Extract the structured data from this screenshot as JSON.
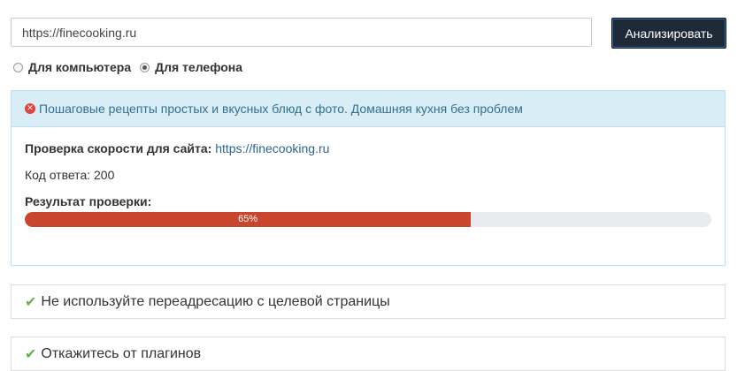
{
  "form": {
    "url_value": "https://finecooking.ru",
    "analyze_label": "Анализировать",
    "radio_desktop": "Для компьютера",
    "radio_mobile": "Для телефона",
    "selected": "mobile"
  },
  "result": {
    "header_text": "Пошаговые рецепты простых и вкусных блюд с фото. Домашняя кухня без проблем",
    "speed_label": "Проверка скорости для сайта:",
    "speed_url": "https://finecooking.ru",
    "response_code_label": "Код ответа: 200",
    "result_label": "Результат проверки:",
    "progress_percent": 65,
    "progress_text": "65%",
    "progress_color": "#c9452e"
  },
  "rules": [
    {
      "label": "Не используйте переадресацию с целевой страницы",
      "status": "passed"
    },
    {
      "label": "Откажитесь от плагинов",
      "status": "passed"
    }
  ]
}
